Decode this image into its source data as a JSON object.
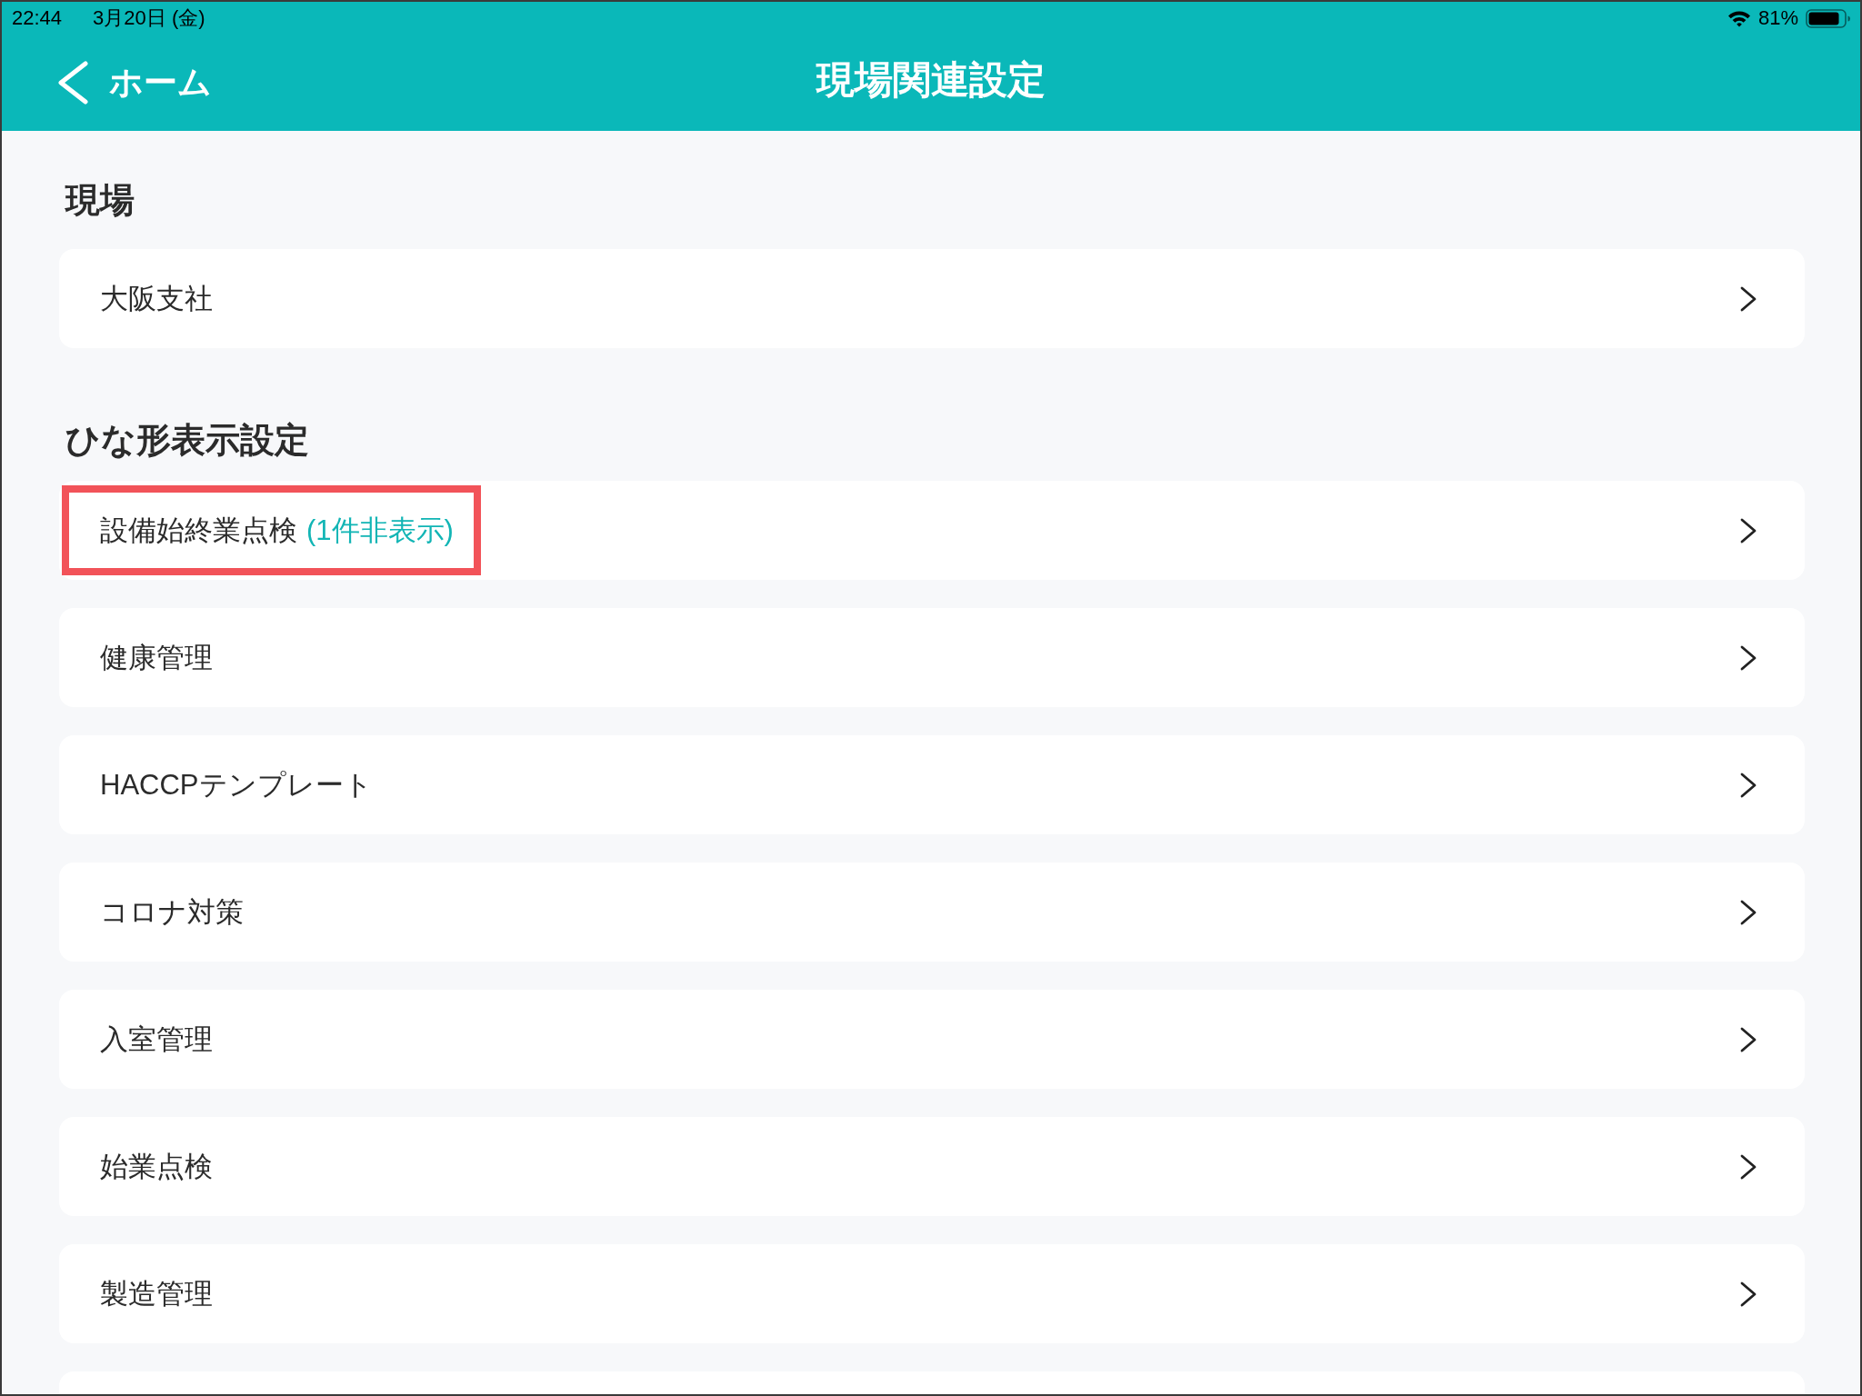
{
  "status_bar": {
    "time": "22:44",
    "date": "3月20日 (金)",
    "battery": "81%"
  },
  "nav_bar": {
    "back_label": "ホーム",
    "title": "現場関連設定"
  },
  "sections": [
    {
      "heading": "現場",
      "rows": [
        {
          "kind": "link",
          "label": "大阪支社",
          "highlighted": false
        }
      ]
    },
    {
      "heading": "ひな形表示設定",
      "rows": [
        {
          "kind": "link",
          "label": "設備始終業点検",
          "note": "(1件非表示)",
          "highlighted": true
        },
        {
          "kind": "link",
          "label": "健康管理",
          "highlighted": false
        },
        {
          "kind": "link",
          "label": "HACCPテンプレート",
          "highlighted": false
        },
        {
          "kind": "link",
          "label": "コロナ対策",
          "highlighted": false
        },
        {
          "kind": "link",
          "label": "入室管理",
          "highlighted": false
        },
        {
          "kind": "link",
          "label": "始業点検",
          "highlighted": false
        },
        {
          "kind": "link",
          "label": "製造管理",
          "highlighted": false
        },
        {
          "kind": "cut_off"
        }
      ]
    }
  ]
}
